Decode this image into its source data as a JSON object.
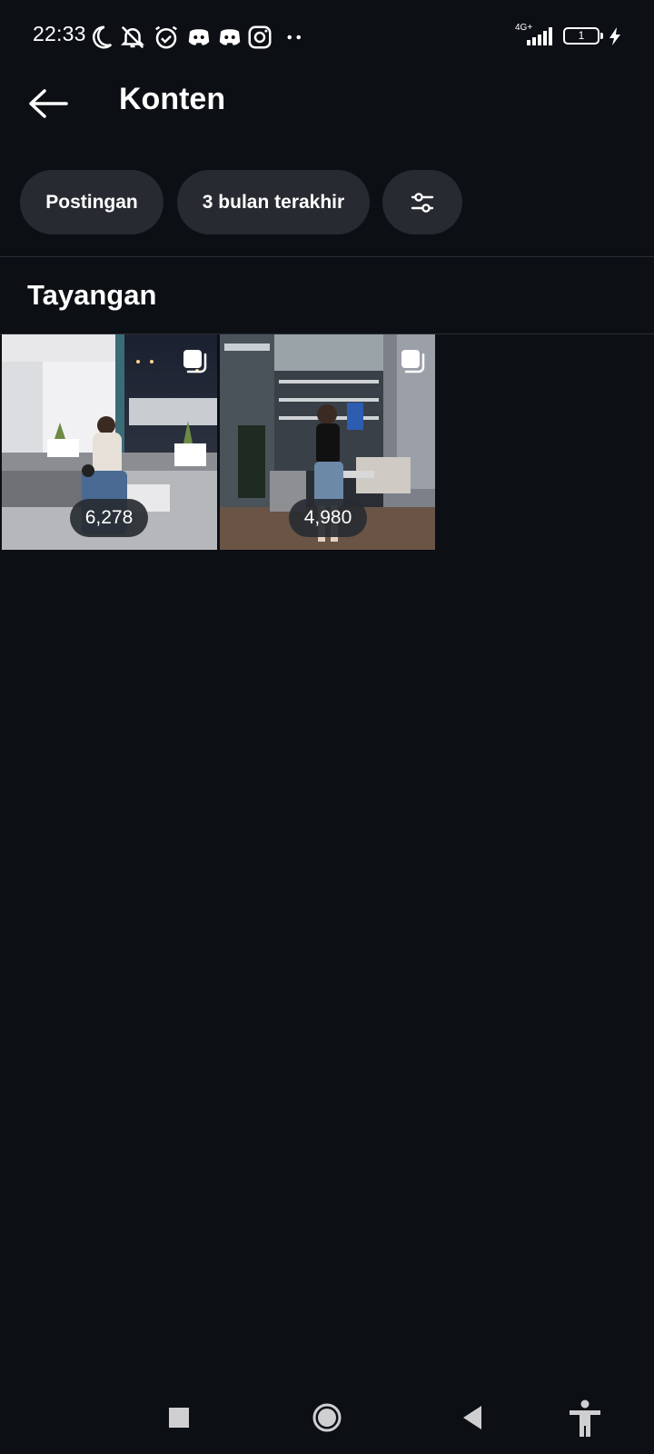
{
  "status_bar": {
    "time": "22:33",
    "network": "4G+",
    "battery": "1",
    "icons": [
      "moon-icon",
      "mute-icon",
      "alarm-icon",
      "discord-icon",
      "discord-icon",
      "instagram-icon",
      "more-dots-icon",
      "signal-icon",
      "battery-icon",
      "charging-icon"
    ]
  },
  "header": {
    "title": "Konten",
    "back_icon": "arrow-left-icon"
  },
  "filters": {
    "content_type": "Postingan",
    "date_range": "3 bulan terakhir",
    "settings_icon": "sliders-icon"
  },
  "section": {
    "title": "Tayangan"
  },
  "posts": [
    {
      "views": "6,278",
      "type_icon": "carousel-icon"
    },
    {
      "views": "4,980",
      "type_icon": "carousel-icon"
    }
  ],
  "nav": {
    "icons": [
      "recents-square-icon",
      "home-circle-icon",
      "back-triangle-icon",
      "accessibility-icon"
    ]
  },
  "colors": {
    "background": "#0c0f14",
    "chip": "#272b31",
    "divider": "#2b2f35",
    "text": "#ffffff"
  }
}
